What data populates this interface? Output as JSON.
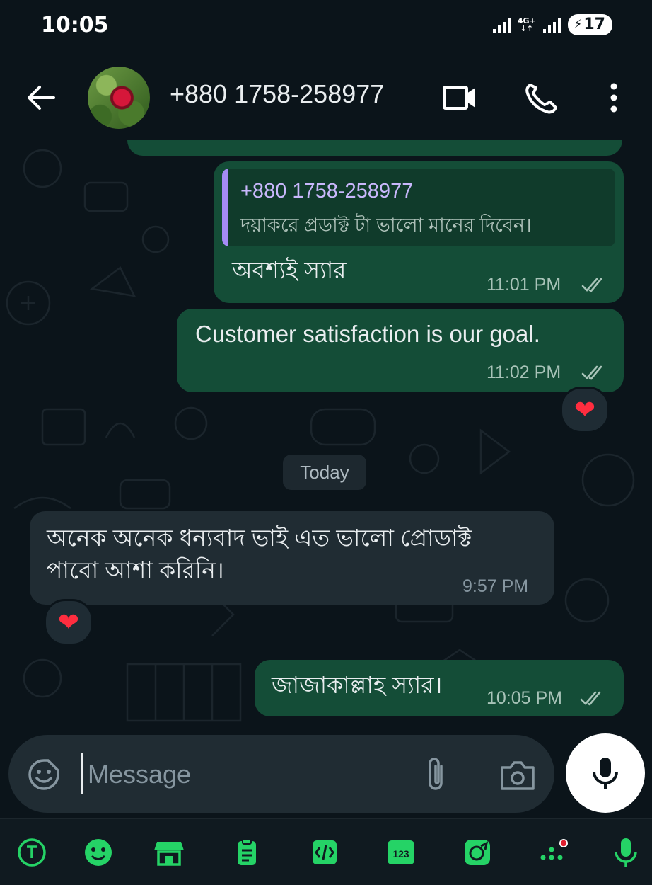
{
  "status_bar": {
    "time": "10:05",
    "network": "4G+",
    "battery": "17",
    "icons": [
      "signal-icon",
      "network-4g-icon",
      "signal-icon",
      "battery-icon"
    ]
  },
  "header": {
    "contact_name": "+880 1758-258977",
    "icons": [
      "back-arrow-icon",
      "contact-avatar",
      "video-call-icon",
      "phone-call-icon",
      "more-options-icon"
    ]
  },
  "messages": [
    {
      "direction": "outgoing",
      "quoted": {
        "name": "+880 1758-258977",
        "text": "দয়াকরে প্রডাক্ট টা ভালো মানের দিবেন।"
      },
      "text": "অবশ্যই স্যার",
      "time": "11:01 PM",
      "status": "read"
    },
    {
      "direction": "outgoing",
      "text": "Customer satisfaction is our goal.",
      "time": "11:02 PM",
      "status": "read",
      "reaction": "❤"
    },
    {
      "direction": "incoming",
      "text_line1": "অনেক অনেক ধন্যবাদ ভাই এত ভালো প্রোডাক্ট",
      "text_line2": "পাবো আশা করিনি।",
      "time": "9:57 PM",
      "reaction": "❤"
    },
    {
      "direction": "outgoing",
      "text": "জাজাকাল্লাহ স্যার।",
      "time": "10:05 PM",
      "status": "read"
    }
  ],
  "date_divider": "Today",
  "composer": {
    "placeholder": "Message",
    "icons": [
      "emoji-sticker-icon",
      "attach-icon",
      "camera-icon",
      "microphone-icon"
    ]
  },
  "keyboard_toolbar": {
    "icons": [
      "translate-icon",
      "emoji-icon",
      "store-icon",
      "clipboard-icon",
      "text-editing-icon",
      "numpad-icon",
      "sticker-icon",
      "more-dots-icon",
      "voice-input-icon"
    ],
    "numpad_label": "123"
  },
  "colors": {
    "background": "#0b141a",
    "outgoing_bubble": "#144d37",
    "incoming_bubble": "#202c33",
    "accent": "#25d366",
    "quote_bar": "#a58bf5",
    "read_ticks": "#a8c3b8",
    "reaction_heart": "#ff2d3f"
  }
}
